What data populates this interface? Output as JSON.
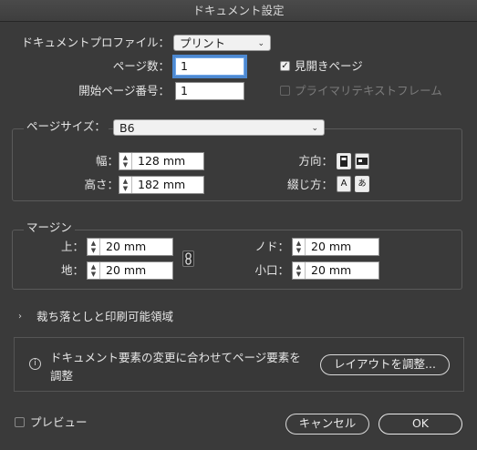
{
  "window": {
    "title": "ドキュメント設定"
  },
  "document": {
    "profile_label": "ドキュメントプロファイル：",
    "profile_value": "プリント",
    "pages_label": "ページ数：",
    "pages_value": "1",
    "start_page_label": "開始ページ番号：",
    "start_page_value": "1",
    "facing_pages_label": "見開きページ",
    "facing_pages_checked": true,
    "primary_frame_label": "プライマリテキストフレーム",
    "primary_frame_checked": false
  },
  "page_size": {
    "group_label": "ページサイズ：",
    "value": "B6",
    "width_label": "幅：",
    "width_value": "128 mm",
    "height_label": "高さ：",
    "height_value": "182 mm",
    "orientation_label": "方向：",
    "binding_label": "綴じ方：",
    "binding_left_glyph": "A",
    "binding_right_glyph": "あ"
  },
  "margins": {
    "group_label": "マージン",
    "top_label": "上：",
    "top_value": "20 mm",
    "bottom_label": "地：",
    "bottom_value": "20 mm",
    "inside_label": "ノド：",
    "inside_value": "20 mm",
    "outside_label": "小口：",
    "outside_value": "20 mm"
  },
  "bleed": {
    "label": "裁ち落としと印刷可能領域",
    "expanded": false
  },
  "info": {
    "message_line1": "ドキュメント要素の変更に合わせてページ要素を",
    "message_line2": "調整",
    "adjust_button": "レイアウトを調整..."
  },
  "footer": {
    "preview_label": "プレビュー",
    "preview_checked": false,
    "cancel_label": "キャンセル",
    "ok_label": "OK"
  },
  "colors": {
    "background": "#3a3a3a",
    "focus_ring": "#4d89d1"
  }
}
